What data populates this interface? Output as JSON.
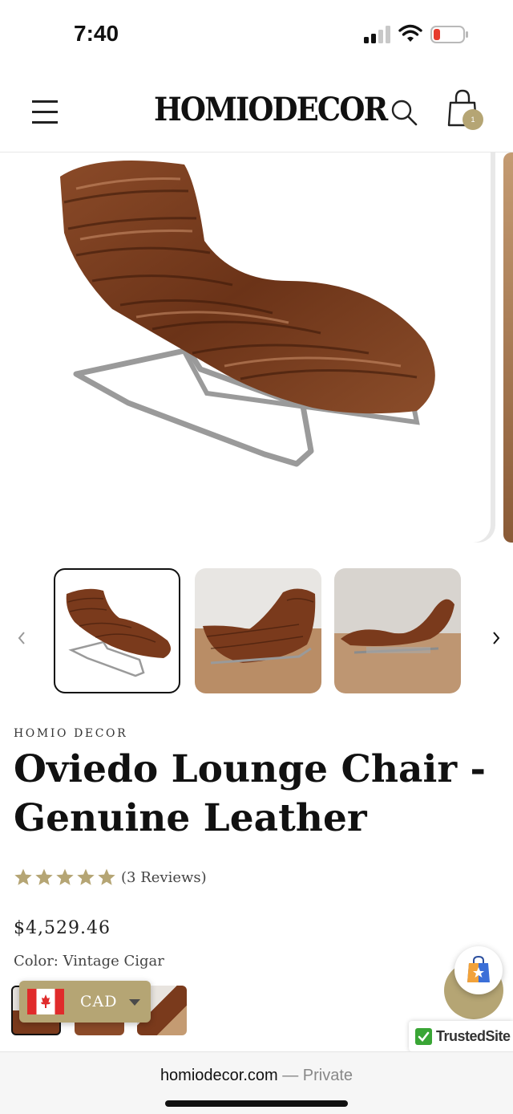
{
  "status_bar": {
    "time": "7:40"
  },
  "header": {
    "logo": "HOMIODECOR",
    "cart_count": "1"
  },
  "product": {
    "vendor": "HOMIO DECOR",
    "title": "Oviedo Lounge Chair - Genuine Leather",
    "rating": 5,
    "reviews_text": "(3 Reviews)",
    "price": "$4,529.46",
    "color_label": "Color: Vintage Cigar"
  },
  "currency": {
    "code": "CAD"
  },
  "trust_badge": {
    "label": "TrustedSite"
  },
  "browser": {
    "domain": "homiodecor.com",
    "mode": " — Private"
  },
  "colors": {
    "accent": "#b5a574",
    "leather": "#7a3f22",
    "chrome": "#8c8c8c"
  },
  "icons": [
    "menu-icon",
    "search-icon",
    "bag-icon",
    "chevron-left-icon",
    "chevron-right-icon",
    "star-icon",
    "canada-flag-icon",
    "caret-down-icon",
    "shopping-bag-star-icon",
    "check-icon"
  ]
}
